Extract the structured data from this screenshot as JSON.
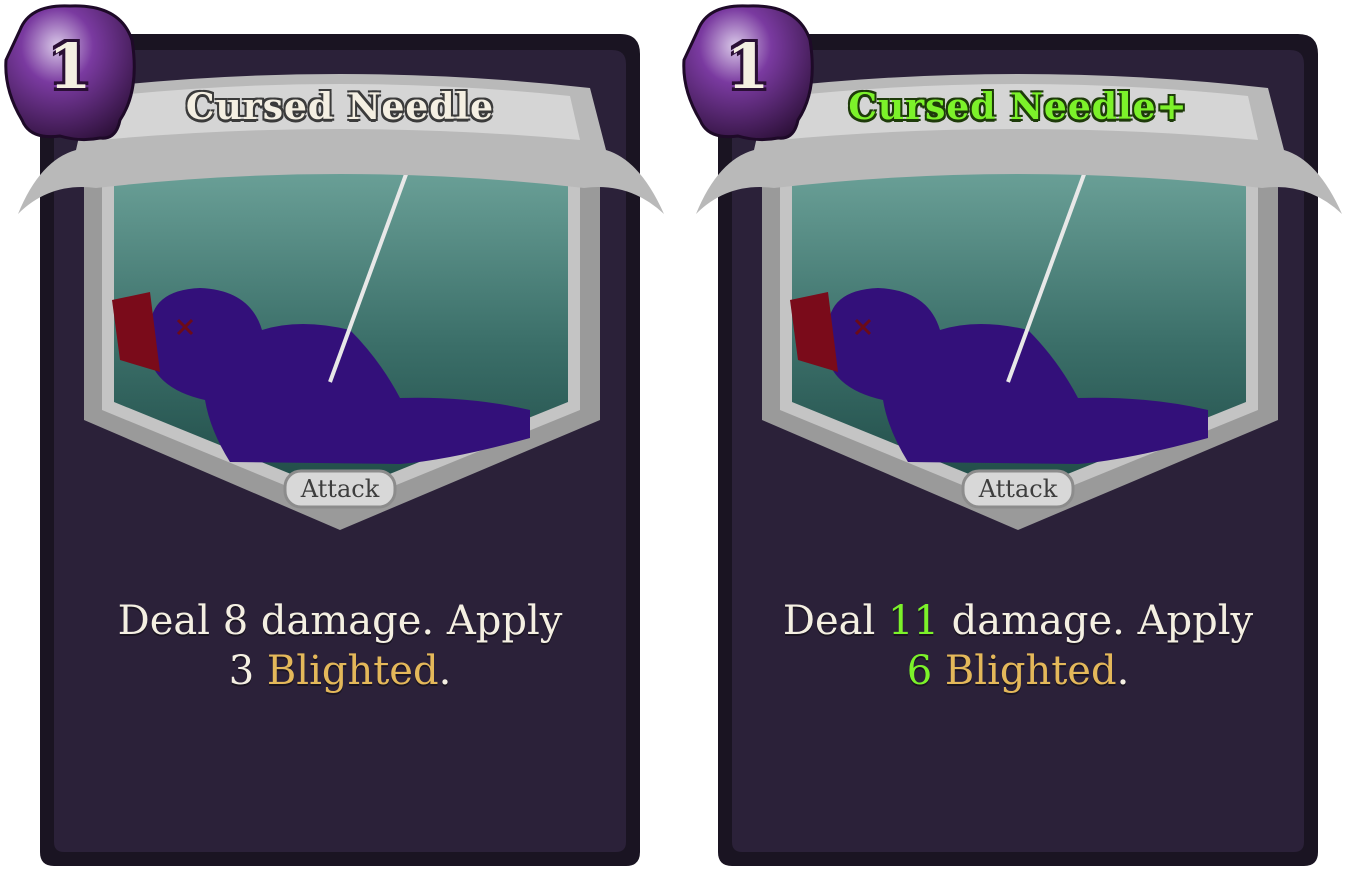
{
  "cards": [
    {
      "cost": "1",
      "title": "Cursed Needle",
      "type": "Attack",
      "description": {
        "part1": "Deal ",
        "damage": "8",
        "part2": " damage. Apply",
        "blight_amount": "3",
        "keyword": "Blighted",
        "end": "."
      },
      "upgraded": false
    },
    {
      "cost": "1",
      "title": "Cursed Needle+",
      "type": "Attack",
      "description": {
        "part1": "Deal ",
        "damage": "11",
        "part2": " damage. Apply",
        "blight_amount": "6",
        "keyword": "Blighted",
        "end": "."
      },
      "upgraded": true
    }
  ],
  "colors": {
    "card_body": "#2b2139",
    "card_border": "#1a1422",
    "banner": "#b9b9b9",
    "art_top": "#5c9188",
    "art_bottom": "#1f4a46",
    "doll": "#33107a",
    "energy_orb": "#5a1d7a",
    "keyword": "#e4b85a",
    "upgrade": "#7cf22a"
  },
  "icons": [
    "energy-orb-icon",
    "voodoo-doll-art",
    "needle-art"
  ]
}
